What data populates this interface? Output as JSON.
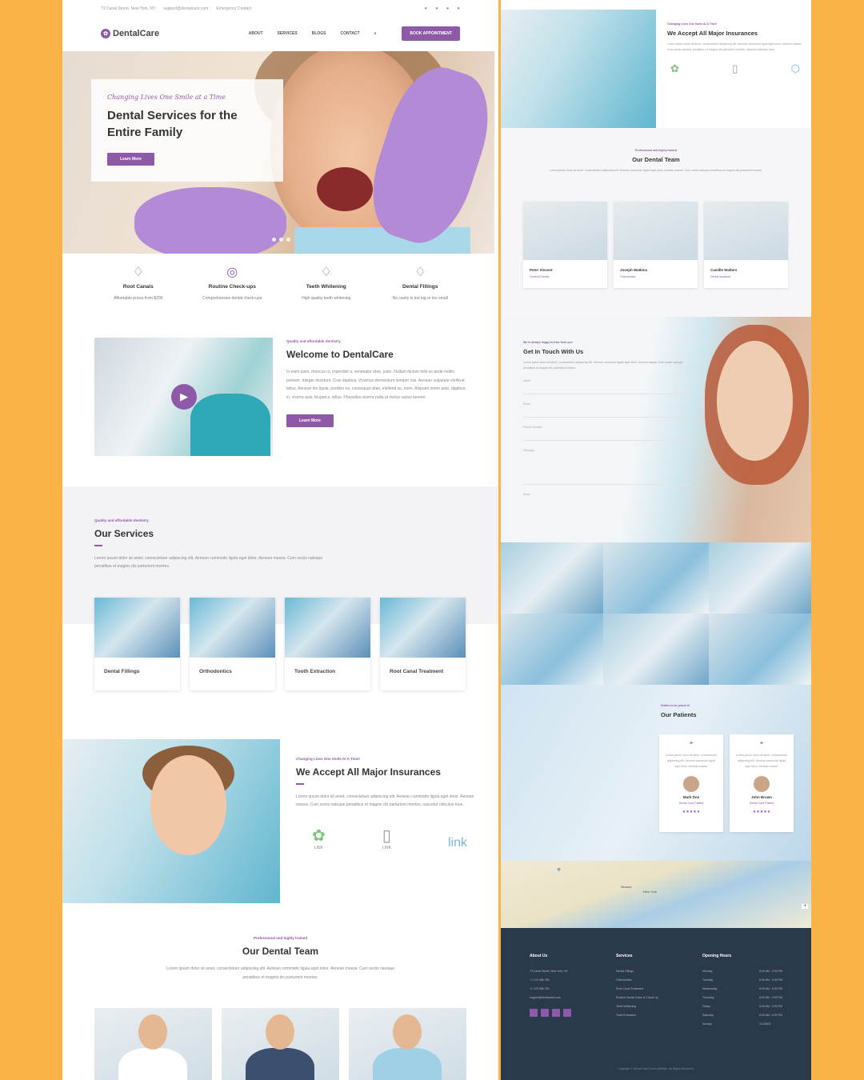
{
  "topbar": {
    "address": "73 Canal Street, New York, NY",
    "email": "support@dentalcare.com",
    "phone": "Emergency Contact"
  },
  "brand": {
    "name": "DentalCare"
  },
  "nav": {
    "items": [
      "ABOUT",
      "SERVICES",
      "BLOGS",
      "CONTACT"
    ],
    "cta": "BOOK APPOINTMENT"
  },
  "hero": {
    "script": "Changing Lives One Smile at a Time",
    "title": "Dental Services for the Entire Family",
    "button": "Learn More"
  },
  "features": [
    {
      "title": "Root Canals",
      "desc": "Affordable prices from $200"
    },
    {
      "title": "Routine Check-ups",
      "desc": "Comprehensive dental check-ups"
    },
    {
      "title": "Teeth Whitening",
      "desc": "High quality teeth whitening"
    },
    {
      "title": "Dental Fillings",
      "desc": "No cavity is too big or too small"
    }
  ],
  "welcome": {
    "eyebrow": "Quality and affordable dentistry",
    "title": "Welcome to DentalCare",
    "text": "In enim justo, rhoncus ut, imperdiet a, venenatis vitae, justo. Nullam dictum felis eu pede mollis pretium. Integer tincidunt. Cras dapibus. Vivamus elementum semper nisi. Aenean vulputate eleifend tellus. Aenean leo ligula, porttitor eu, consequat vitae, eleifend ac, enim. Aliquam lorem ante, dapibus in, viverra quis, feugiat a, tellus. Phasellus viverra nulla ut metus varius laoreet.",
    "button": "Learn More"
  },
  "services": {
    "eyebrow": "Quality and affordable dentistry",
    "title": "Our Services",
    "text": "Lorem ipsum dolor sit amet, consectetuer adipiscing elit. Aenean commodo ligula eget dolor. Aenean massa. Cum sociis natoque penatibus et magnis dis parturient montes.",
    "cards": [
      "Dental Fillings",
      "Orthodontics",
      "Tooth Extraction",
      "Root Canal Treatment"
    ]
  },
  "insurance": {
    "eyebrow": "Changing Lives One Smile At A Time!",
    "title": "We Accept All Major Insurances",
    "text": "Lorem ipsum dolor sit amet, consectetuer adipiscing elit. Aenean commodo ligula eget dolor. Aenean massa. Cum sociis natoque penatibus et magnis dis parturient montes, nascetur ridiculus mus.",
    "logos": [
      "LINK",
      "LINK",
      "link"
    ]
  },
  "team": {
    "eyebrow": "Professional and highly trained",
    "title": "Our Dental Team",
    "text": "Lorem ipsum dolor sit amet, consectetuer adipiscing elit. Aenean commodo ligula eget dolor. Aenean massa. Cum sociis natoque penatibus et magnis dis parturient montes.",
    "members": [
      {
        "name": "Peter Vincent",
        "role": "General Dentist"
      },
      {
        "name": "Joseph Watkins",
        "role": "Orthodontist"
      },
      {
        "name": "Camille Walters",
        "role": "Dental Assistant"
      }
    ]
  },
  "contact": {
    "eyebrow": "We're always happy to hear from you",
    "title": "Get In Touch With Us",
    "text": "Lorem ipsum dolor sit amet, consectetuer adipiscing elit. Aenean commodo ligula eget dolor. Aenean massa. Cum sociis natoque penatibus et magnis dis parturient montes.",
    "fields": [
      "Name",
      "Email",
      "Phone Number",
      "Message"
    ],
    "button": "Send"
  },
  "patients": {
    "eyebrow": "Smiles to be proud of",
    "title": "Our Patients",
    "quote": "Lorem ipsum dolor sit amet, consectetuer adipiscing elit. Aenean commodo ligula eget dolor. Aenean massa.",
    "list": [
      {
        "name": "Mark Doe",
        "role": "Dental Care Patient",
        "stars": "★★★★★"
      },
      {
        "name": "John Brown",
        "role": "Dental Care Patient",
        "stars": "★★★★★"
      }
    ]
  },
  "map": {
    "labels": [
      "New York",
      "Newark"
    ]
  },
  "footer": {
    "about": {
      "title": "About Us",
      "lines": [
        "73 Canal Street, New York, NY",
        "+1 123 456 789",
        "+1 123 456 789",
        "support@dentalcare.com"
      ]
    },
    "services": {
      "title": "Services",
      "lines": [
        "Dental Fillings",
        "Orthodontics",
        "Root Canal Treatment",
        "Routine Dental Exam & Check Up",
        "Teeth Whitening",
        "Tooth Extraction"
      ]
    },
    "hours": {
      "title": "Opening Hours",
      "days": [
        "Monday",
        "Tuesday",
        "Wednesday",
        "Thursday",
        "Friday",
        "Saturday",
        "Sunday"
      ],
      "times": [
        "8:00 AM - 9:00 PM",
        "8:00 AM - 9:00 PM",
        "8:00 AM - 9:00 PM",
        "8:00 AM - 9:00 PM",
        "8:00 AM - 9:00 PM",
        "8:00 AM - 9:00 PM",
        "CLOSED"
      ]
    },
    "copyright": "Copyright © Dental Care Demo Website. All Rights Reserved."
  },
  "colors": {
    "accent": "#8e5aa8",
    "background": "#f9b347",
    "footer": "#2a3a4a"
  }
}
